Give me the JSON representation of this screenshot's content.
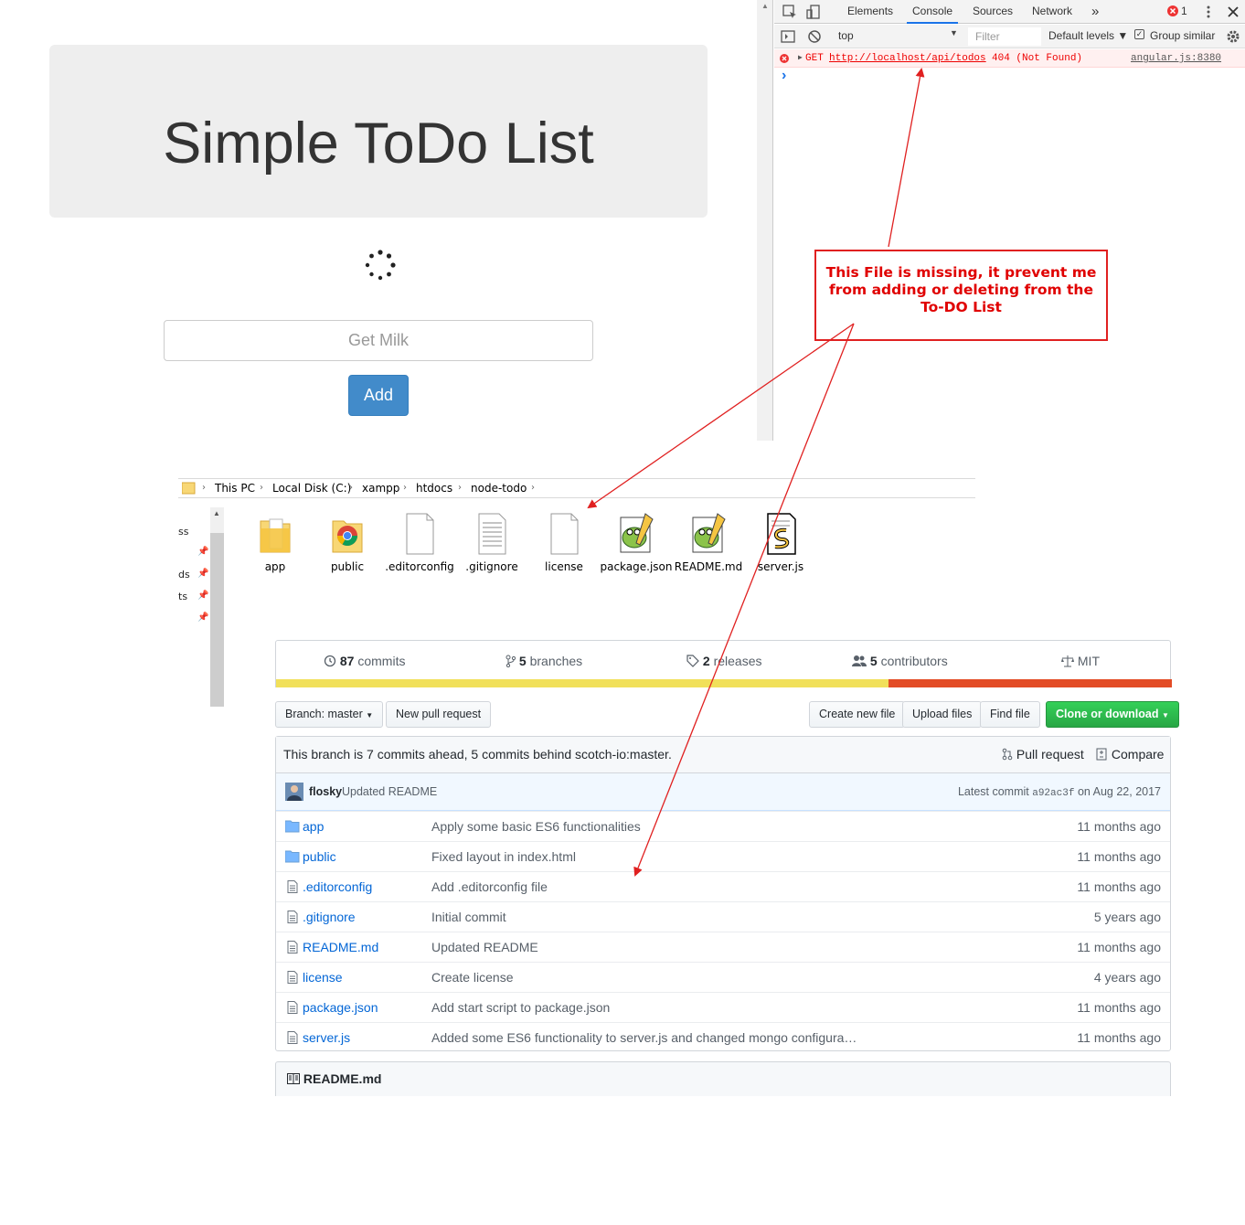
{
  "todo": {
    "title": "Simple ToDo List",
    "input_placeholder": "Get Milk",
    "add_label": "Add"
  },
  "devtools": {
    "tabs": [
      "Elements",
      "Console",
      "Sources",
      "Network"
    ],
    "active_tab": "Console",
    "more": "»",
    "error_count": "1",
    "context": "top",
    "filter_placeholder": "Filter",
    "levels": "Default levels ▼",
    "group_similar": "Group similar",
    "error": {
      "method": "GET",
      "url": "http://localhost/api/todos",
      "status": "404 (Not Found)",
      "source": "angular.js:8380"
    },
    "prompt": "›"
  },
  "annotation": {
    "text": "This File is missing, it prevent me from adding or deleting from the To-DO List"
  },
  "explorer": {
    "breadcrumb": [
      "This PC",
      "Local Disk (C:)",
      "xampp",
      "htdocs",
      "node-todo"
    ],
    "nav_fragments": [
      "ss",
      "ds",
      "ts"
    ],
    "files": [
      {
        "name": "app",
        "icon": "folder-icon"
      },
      {
        "name": "public",
        "icon": "chrome-folder-icon"
      },
      {
        "name": ".editorconfig",
        "icon": "file-icon"
      },
      {
        "name": ".gitignore",
        "icon": "text-file-icon"
      },
      {
        "name": "license",
        "icon": "file-icon"
      },
      {
        "name": "package.json",
        "icon": "notepadpp-icon"
      },
      {
        "name": "README.md",
        "icon": "notepadpp-icon"
      },
      {
        "name": "server.js",
        "icon": "script-icon"
      }
    ]
  },
  "github": {
    "stats": {
      "commits_count": "87",
      "commits_label": "commits",
      "branches_count": "5",
      "branches_label": "branches",
      "releases_count": "2",
      "releases_label": "releases",
      "contributors_count": "5",
      "contributors_label": "contributors",
      "license": "MIT"
    },
    "colors": {
      "lang1": "#f1e05a",
      "lang2": "#e34c26"
    },
    "branch_button": "Branch: master",
    "new_pr": "New pull request",
    "create_file": "Create new file",
    "upload_files": "Upload files",
    "find_file": "Find file",
    "clone": "Clone or download",
    "branch_info": "This branch is 7 commits ahead, 5 commits behind scotch-io:master.",
    "pull_request": "Pull request",
    "compare": "Compare",
    "commit": {
      "author": "flosky",
      "message": "Updated README",
      "latest_label": "Latest commit",
      "sha": "a92ac3f",
      "date": "on Aug 22, 2017"
    },
    "files": [
      {
        "name": "app",
        "message": "Apply some basic ES6 functionalities",
        "age": "11 months ago",
        "type": "dir"
      },
      {
        "name": "public",
        "message": "Fixed layout in index.html",
        "age": "11 months ago",
        "type": "dir"
      },
      {
        "name": ".editorconfig",
        "message": "Add .editorconfig file",
        "age": "11 months ago",
        "type": "file"
      },
      {
        "name": ".gitignore",
        "message": "Initial commit",
        "age": "5 years ago",
        "type": "file"
      },
      {
        "name": "README.md",
        "message": "Updated README",
        "age": "11 months ago",
        "type": "file"
      },
      {
        "name": "license",
        "message": "Create license",
        "age": "4 years ago",
        "type": "file"
      },
      {
        "name": "package.json",
        "message": "Add start script to package.json",
        "age": "11 months ago",
        "type": "file"
      },
      {
        "name": "server.js",
        "message": "Added some ES6 functionality to server.js and changed mongo configura…",
        "age": "11 months ago",
        "type": "file"
      }
    ],
    "readme_title": "README.md"
  }
}
